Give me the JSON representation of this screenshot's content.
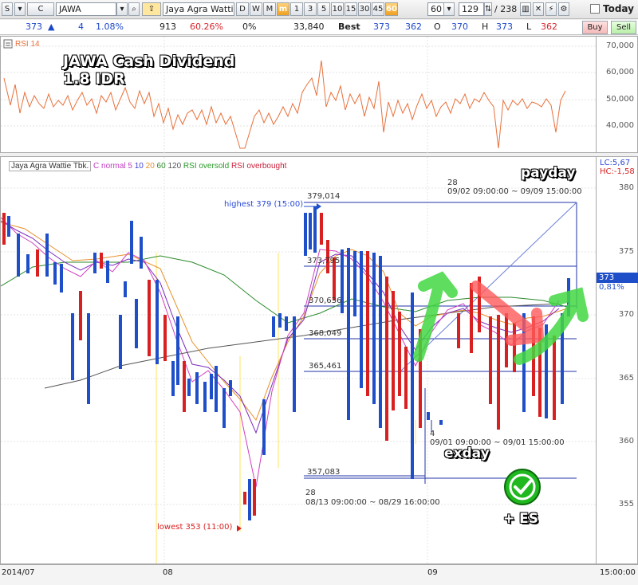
{
  "toolbar": {
    "market_code": "S",
    "type_code": "C",
    "ticker": "JAWA",
    "company_name": "Jaya Agra Wattie",
    "periods": [
      "D",
      "W",
      "M",
      "m",
      "1",
      "3",
      "5",
      "10",
      "15",
      "30",
      "45",
      "60"
    ],
    "active_period": "m",
    "active_interval": "60",
    "interval_value": "60",
    "bars_shown": "129",
    "bars_total": "238",
    "today_label": "Today"
  },
  "quote": {
    "last": "373",
    "change": "4",
    "change_pct": "1.08%",
    "volume": "913",
    "volume_pct": "60.26%",
    "zero_pct": "0%",
    "value": "33,840",
    "best_label": "Best",
    "best_bid": "373",
    "best_ask": "362",
    "open_label": "O",
    "open": "370",
    "high_label": "H",
    "high": "373",
    "low_label": "L",
    "low": "362",
    "buy_label": "Buy",
    "sell_label": "Sell"
  },
  "rsi_pane": {
    "title": "RSI 14",
    "annotation": "JAWA Cash Dividend\n1.8 IDR",
    "ticks": [
      "70,000",
      "60,000",
      "50,000",
      "40,000"
    ]
  },
  "price_pane": {
    "legend": [
      "Jaya Agra Wattie Tbk.",
      "C normal 5",
      "10",
      "20",
      "60",
      "120",
      "RSI oversold",
      "RSI overbought"
    ],
    "ticks": [
      "380",
      "375",
      "370",
      "365",
      "360",
      "355"
    ],
    "lc_label": "LC:5,67",
    "hc_label": "HC:-1,58",
    "current_price_tag": "373",
    "current_pct_tag": "0,81%",
    "highest_label": "highest 379 (15:00)",
    "lowest_label": "lowest 353 (11:00)",
    "fib_levels": [
      "379,014",
      "373,795",
      "370,636",
      "368,049",
      "365,461",
      "357,083"
    ],
    "range1_count": "28",
    "range1_dates": "09/02 09:00:00 ~ 09/09 15:00:00",
    "range2_count": "28",
    "range2_dates": "08/13 09:00:00 ~ 08/29 16:00:00",
    "range3_count": "4",
    "range3_dates": "09/01 09:00:00 ~ 09/01 15:00:00",
    "payday_label": "payday",
    "exday_label": "exday",
    "es_label": "+ ES"
  },
  "date_axis": {
    "labels": [
      "2014/07",
      "08",
      "09"
    ],
    "time_label": "15:00:00"
  },
  "colors": {
    "up": "#1f4fc8",
    "down": "#d82020",
    "rsi": "#e8703a",
    "green_arrow": "#43d843",
    "red_arrow": "#ff5a5a",
    "check_green": "#1fb81f"
  }
}
